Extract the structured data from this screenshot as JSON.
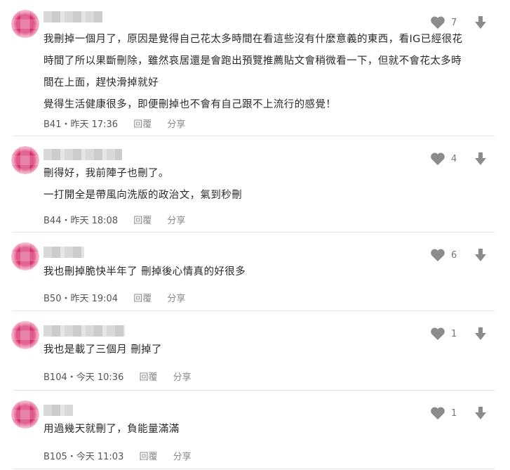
{
  "comments": [
    {
      "lines": [
        "我刪掉一個月了，原因是覺得自己花太多時間在看這些沒有什麼意義的東西，看IG已經很花",
        "時間了所以果斷刪除，雖然哀居還是會跑出預覽推薦貼文會稍微看一下，但就不會花太多時",
        "間在上面，趕快滑掉就好",
        "覺得生活健康很多，即便刪掉也不會有自己跟不上流行的感覺！"
      ],
      "floor": "B41",
      "time": "昨天 17:36",
      "reply": "回覆",
      "share": "分享",
      "likes": "7"
    },
    {
      "lines": [
        "刪得好，我前陣子也刪了。",
        "一打開全是帶風向洗版的政治文，氣到秒刪"
      ],
      "floor": "B44",
      "time": "昨天 18:08",
      "reply": "回覆",
      "share": "分享",
      "likes": "4"
    },
    {
      "lines": [
        "我也刪掉脆快半年了 刪掉後心情真的好很多"
      ],
      "floor": "B50",
      "time": "昨天 19:04",
      "reply": "回覆",
      "share": "分享",
      "likes": "6"
    },
    {
      "lines": [
        "我也是載了三個月 刪掉了"
      ],
      "floor": "B104",
      "time": "今天 10:36",
      "reply": "回覆",
      "share": "分享",
      "likes": "1"
    },
    {
      "lines": [
        "用過幾天就刪了，負能量滿滿"
      ],
      "floor": "B105",
      "time": "今天 11:03",
      "reply": "回覆",
      "share": "分享",
      "likes": "1"
    }
  ],
  "icons": {
    "like": "heart-icon",
    "dislike": "arrow-down-icon"
  },
  "colors": {
    "avatar": "#d1336b",
    "icon": "#8c8c8c",
    "divider": "#e3e3e3"
  }
}
